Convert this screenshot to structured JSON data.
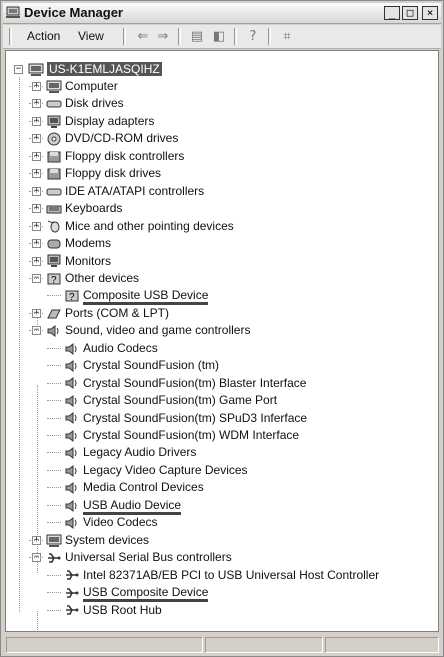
{
  "window": {
    "title": "Device Manager",
    "buttons": {
      "minimize": "_",
      "maximize": "□",
      "close": "×"
    }
  },
  "menu": {
    "action": "Action",
    "view": "View"
  },
  "toolbar": {
    "items": [
      "back-icon",
      "forward-icon",
      "properties-icon",
      "view-icon",
      "help-icon",
      "scan-icon"
    ]
  },
  "tree": {
    "root": "US-K1EMLJASQIHZ",
    "categories": [
      {
        "label": "Computer",
        "icon": "computer-icon"
      },
      {
        "label": "Disk drives",
        "icon": "disk-icon"
      },
      {
        "label": "Display adapters",
        "icon": "display-icon"
      },
      {
        "label": "DVD/CD-ROM drives",
        "icon": "dvd-icon"
      },
      {
        "label": "Floppy disk controllers",
        "icon": "floppy-controller-icon"
      },
      {
        "label": "Floppy disk drives",
        "icon": "floppy-icon"
      },
      {
        "label": "IDE ATA/ATAPI controllers",
        "icon": "ide-icon"
      },
      {
        "label": "Keyboards",
        "icon": "keyboard-icon"
      },
      {
        "label": "Mice and other pointing devices",
        "icon": "mouse-icon"
      },
      {
        "label": "Modems",
        "icon": "modem-icon"
      },
      {
        "label": "Monitors",
        "icon": "monitor-icon"
      },
      {
        "label": "Other devices",
        "icon": "question-icon"
      }
    ],
    "other_devices_children": [
      "Composite USB Device"
    ],
    "ports": "Ports (COM & LPT)",
    "sound": "Sound, video and game controllers",
    "sound_children": [
      "Audio Codecs",
      "Crystal SoundFusion (tm)",
      "Crystal SoundFusion(tm) Blaster Interface",
      "Crystal SoundFusion(tm) Game Port",
      "Crystal SoundFusion(tm) SPuD3 Inferface",
      "Crystal SoundFusion(tm) WDM Interface",
      "Legacy Audio Drivers",
      "Legacy Video Capture Devices",
      "Media Control Devices",
      "USB Audio Device",
      "Video Codecs"
    ],
    "system": "System devices",
    "usb": "Universal Serial Bus controllers",
    "usb_children": [
      "Intel 82371AB/EB PCI to USB Universal Host Controller",
      "USB Composite Device",
      "USB Root Hub"
    ]
  }
}
